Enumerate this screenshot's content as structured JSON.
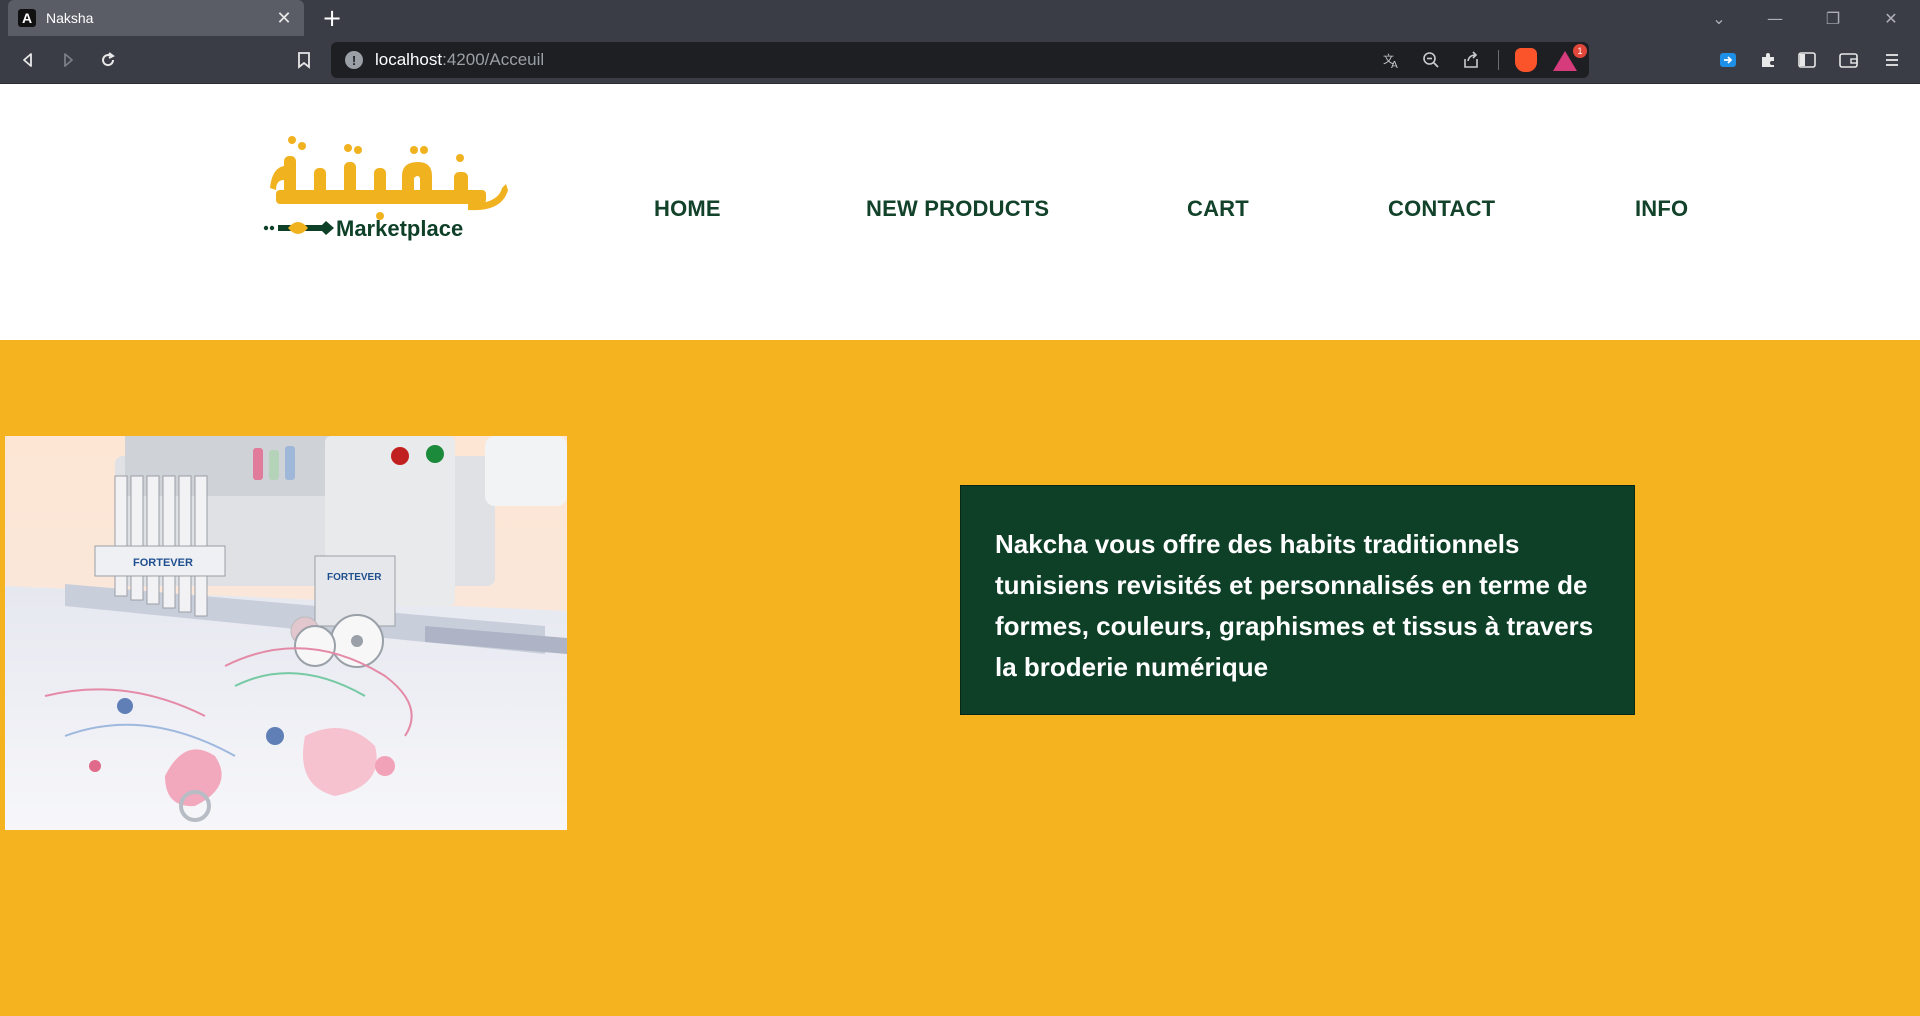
{
  "browser": {
    "tab_title": "Naksha",
    "tab_favicon_letter": "A",
    "url_host": "localhost",
    "url_rest": ":4200/Acceuil",
    "rewards_badge": "1",
    "icons": [
      "back-icon",
      "forward-icon",
      "reload-icon",
      "bookmark-icon",
      "site-info-icon",
      "translate-icon",
      "zoom-out-icon",
      "share-icon",
      "brave-shields-icon",
      "brave-rewards-icon",
      "extension-icon",
      "puzzle-icon",
      "sidebar-icon",
      "wallet-icon",
      "menu-icon"
    ]
  },
  "header": {
    "logo_text": "Marketplace",
    "nav": [
      {
        "label": "HOME"
      },
      {
        "label": "NEW PRODUCTS"
      },
      {
        "label": "CART"
      },
      {
        "label": "CONTACT"
      },
      {
        "label": "INFO"
      }
    ]
  },
  "hero": {
    "machine_brand": "FORTEVER",
    "text": "Nakcha vous offre des habits traditionnels tunisiens revisités et personnalisés en terme de formes, couleurs, graphismes et tissus à travers la broderie numérique"
  },
  "colors": {
    "brand_yellow": "#f5b31f",
    "brand_green": "#0e3f27",
    "nav_text": "#12422a",
    "chrome_bg": "#3a3d45"
  }
}
